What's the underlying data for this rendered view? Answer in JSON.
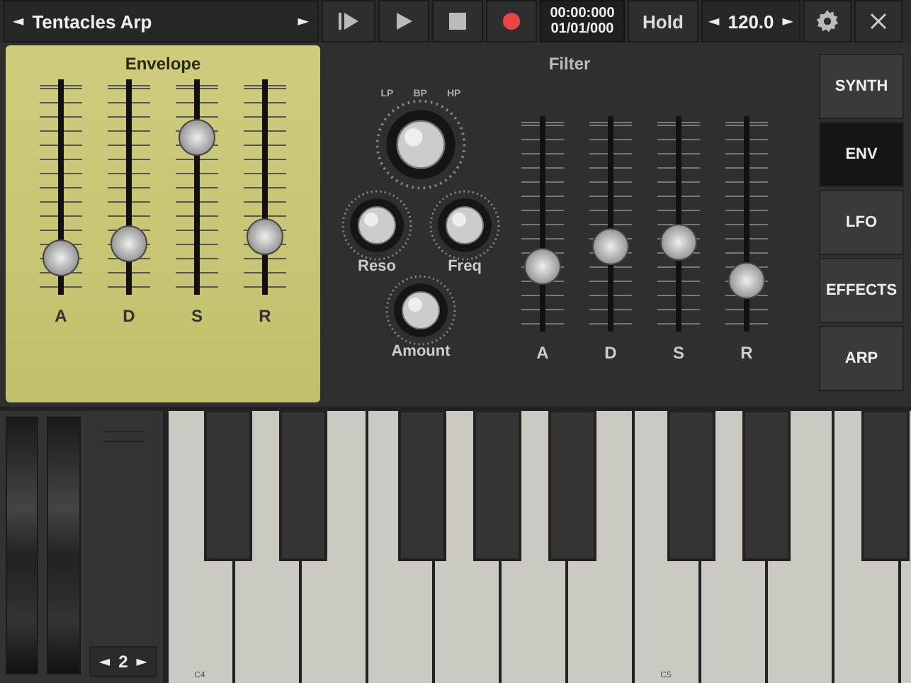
{
  "top_bar": {
    "preset": {
      "prev": "◄",
      "name": "Tentacles Arp",
      "next": "►"
    },
    "transport": [
      {
        "kind": "step"
      },
      {
        "kind": "play"
      },
      {
        "kind": "stop"
      },
      {
        "kind": "record"
      }
    ],
    "time": "00:00:000",
    "position": "01/01/000",
    "hold": "Hold",
    "tempo": {
      "prev": "◄",
      "value": "120.0",
      "next": "►"
    }
  },
  "envelope": {
    "title": "Envelope",
    "sliders": [
      {
        "label": "A",
        "level": 0.1
      },
      {
        "label": "D",
        "level": 0.18
      },
      {
        "label": "S",
        "level": 0.78
      },
      {
        "label": "R",
        "level": 0.22
      }
    ]
  },
  "filter": {
    "title": "Filter",
    "type_labels": [
      "LP",
      "BP",
      "HP"
    ],
    "knobs": [
      {
        "label": "Reso"
      },
      {
        "label": "Freq"
      },
      {
        "label": "Amount"
      }
    ],
    "sliders": [
      {
        "label": "A",
        "level": 0.26
      },
      {
        "label": "D",
        "level": 0.37
      },
      {
        "label": "S",
        "level": 0.4
      },
      {
        "label": "R",
        "level": 0.18
      }
    ]
  },
  "tabs": [
    {
      "label": "SYNTH",
      "selected": false
    },
    {
      "label": "ENV",
      "selected": true
    },
    {
      "label": "LFO",
      "selected": false
    },
    {
      "label": "EFFECTS",
      "selected": false
    },
    {
      "label": "ARP",
      "selected": false
    }
  ],
  "keyboard": {
    "octave": {
      "prev": "◄",
      "value": "2",
      "next": "►"
    },
    "octave_labels": [
      "C4",
      "C5"
    ]
  }
}
